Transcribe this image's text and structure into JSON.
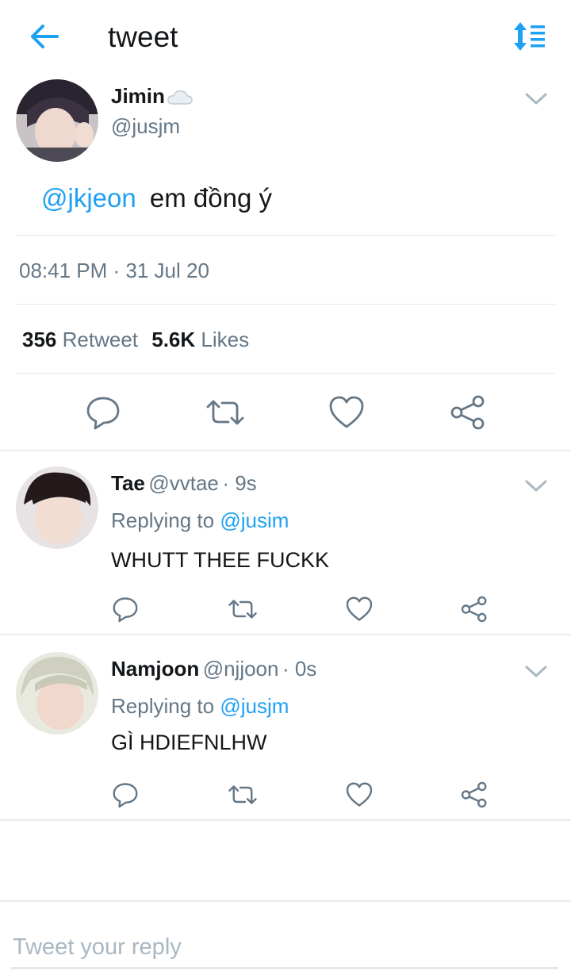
{
  "header": {
    "title": "tweet",
    "back_icon": "arrow-left-icon",
    "sort_icon": "sort-lines-icon"
  },
  "main_tweet": {
    "display_name": "Jimin",
    "name_emoji": "cloud-icon",
    "handle": "@jusjm",
    "mention": "@jkjeon",
    "text": "em đồng ý",
    "timestamp": "08:41 PM · 31 Jul 20",
    "retweet_count": "356",
    "retweet_label": "Retweet",
    "likes_count": "5.6K",
    "likes_label": "Likes"
  },
  "replies": [
    {
      "display_name": "Tae",
      "handle": "@vvtae",
      "time": "· 9s",
      "replying_prefix": "Replying to",
      "replying_to": "@jusim",
      "text": "WHUTT THEE FUCKK"
    },
    {
      "display_name": "Namjoon",
      "handle": "@njjoon",
      "time": "· 0s",
      "replying_prefix": "Replying to",
      "replying_to": "@jusjm",
      "text": "GÌ HDIEFNLHW"
    }
  ],
  "composer": {
    "placeholder": "Tweet your reply"
  },
  "colors": {
    "accent": "#1da1f2",
    "secondary_text": "#657786",
    "divider": "#e1e8ed"
  }
}
